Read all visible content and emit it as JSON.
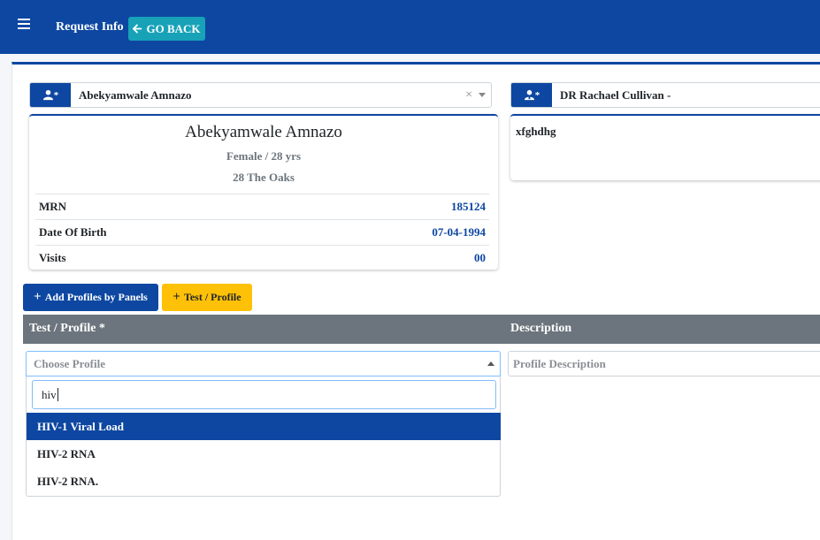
{
  "header": {
    "title": "Request Info",
    "go_back_label": "GO BACK"
  },
  "patient_select": {
    "icon_badge": "*",
    "value": "Abekyamwale Amnazo",
    "clear": "×"
  },
  "doctor_select": {
    "icon_badge": "*",
    "value": "DR Rachael Cullivan -"
  },
  "patient_card": {
    "name": "Abekyamwale Amnazo",
    "gender_age": "Female / 28 yrs",
    "address": "28 The Oaks",
    "rows": [
      {
        "label": "MRN",
        "value": "185124"
      },
      {
        "label": "Date Of Birth",
        "value": "07-04-1994"
      },
      {
        "label": "Visits",
        "value": "00"
      }
    ]
  },
  "doctor_card": {
    "note": "xfghdhg"
  },
  "buttons": {
    "add_profiles": "Add Profiles by Panels",
    "test_profile": "Test / Profile"
  },
  "table": {
    "col_test": "Test / Profile *",
    "col_description": "Description"
  },
  "profile_select": {
    "placeholder": "Choose Profile",
    "search_value": "hiv",
    "options": [
      "HIV-1 Viral Load",
      "HIV-2 RNA",
      "HIV-2 RNA."
    ]
  },
  "description_input": {
    "placeholder": "Profile Description"
  },
  "colors": {
    "primary": "#0d47a1",
    "info": "#17a2b8",
    "warning": "#ffc107",
    "table_header": "#6c757d"
  }
}
